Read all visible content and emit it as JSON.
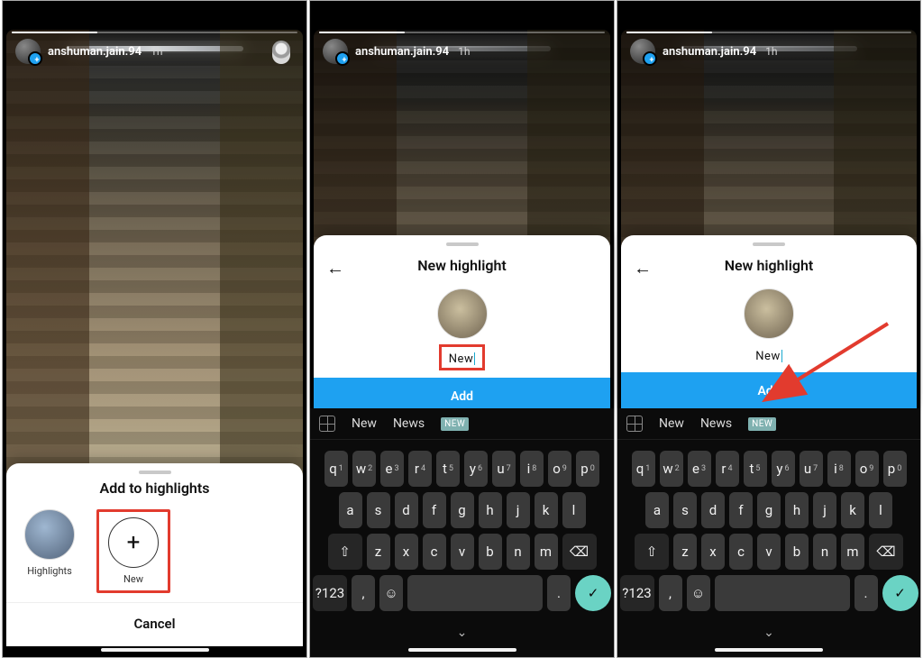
{
  "user": {
    "name": "anshuman.jain.94",
    "time": "1h"
  },
  "panel1": {
    "sheet_title": "Add to highlights",
    "highlights_label": "Highlights",
    "new_label": "New",
    "cancel": "Cancel"
  },
  "panel23": {
    "title": "New highlight",
    "name_value": "New",
    "add": "Add"
  },
  "keyboard": {
    "suggestions": {
      "s1": "New",
      "s2": "News",
      "badge": "NEW"
    },
    "row1_sup": [
      "1",
      "2",
      "3",
      "4",
      "5",
      "6",
      "7",
      "8",
      "9",
      "0"
    ],
    "numkey": "?123"
  }
}
